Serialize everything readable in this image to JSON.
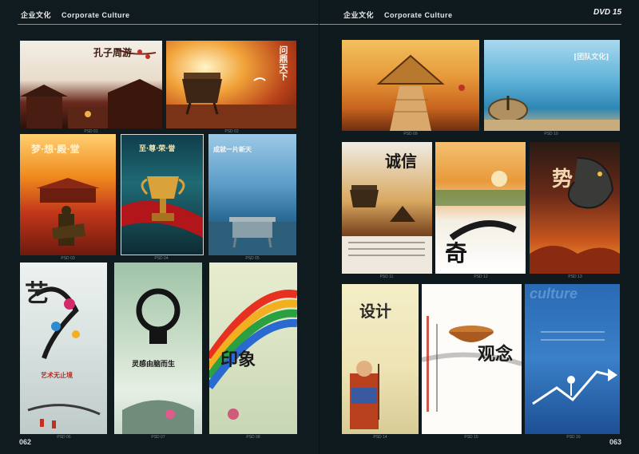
{
  "header": {
    "left": {
      "zh": "企业文化",
      "en": "Corporate Culture"
    },
    "right": {
      "zh": "企业文化",
      "en": "Corporate Culture"
    },
    "logo": "DVD 15"
  },
  "page_numbers": {
    "left": "062",
    "right": "063"
  },
  "left_page": {
    "items": [
      {
        "caption": "PSD 01",
        "title": "孔子周游"
      },
      {
        "caption": "PSD 02",
        "title": "问鼎天下"
      },
      {
        "caption": "PSD 03",
        "title": "梦·想·殿·堂"
      },
      {
        "caption": "PSD 04",
        "title": "至·尊·荣·誉"
      },
      {
        "caption": "PSD 05",
        "title": "成就一片新天"
      },
      {
        "caption": "PSD 06",
        "title": "艺",
        "subtitle": "艺术无止境"
      },
      {
        "caption": "PSD 07",
        "title": "灵感由脑而生"
      },
      {
        "caption": "PSD 08",
        "title": "印象"
      }
    ]
  },
  "right_page": {
    "items": [
      {
        "caption": "PSD 09",
        "title": ""
      },
      {
        "caption": "PSD 10",
        "title": "[团队文化]"
      },
      {
        "caption": "PSD 11",
        "title": "诚信"
      },
      {
        "caption": "PSD 12",
        "title": "奇"
      },
      {
        "caption": "PSD 13",
        "title": "势"
      },
      {
        "caption": "PSD 14",
        "title": "设计"
      },
      {
        "caption": "PSD 15",
        "title": "观念"
      },
      {
        "caption": "PSD 16",
        "title": "culture"
      }
    ]
  },
  "colors": {
    "background": "#101b20",
    "header_text": "#e8e8e8",
    "rule": "#8a8f91"
  }
}
